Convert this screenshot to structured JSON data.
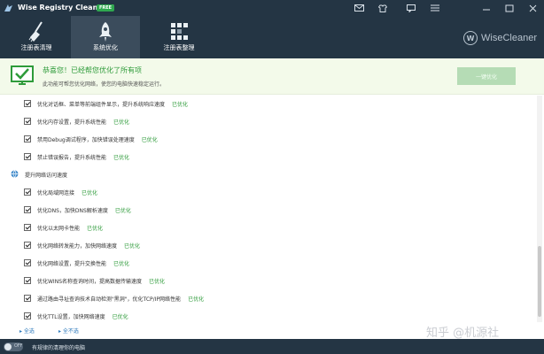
{
  "titlebar": {
    "title": "Wise Registry Cleaner X",
    "badge": "FREE"
  },
  "toolbar": {
    "tabs": [
      {
        "label": "注册表清理",
        "icon": "broom-icon",
        "active": false
      },
      {
        "label": "系统优化",
        "icon": "rocket-icon",
        "active": true
      },
      {
        "label": "注册表整理",
        "icon": "defrag-icon",
        "active": false
      }
    ],
    "brand": {
      "logo_letter": "W",
      "name": "WiseCleaner"
    }
  },
  "banner": {
    "title": "恭喜您！已经帮您优化了所有项",
    "subtitle": "此功能可帮您优化网络，使您的电脑快速稳定运行。",
    "button_label": "一键优化"
  },
  "items_top": [
    {
      "text": "优化对话框、菜单等前端组件显示，提升系统响应速度",
      "status": "已优化"
    },
    {
      "text": "优化内存设置，提升系统性能",
      "status": "已优化"
    },
    {
      "text": "禁用Debug调试程序，加快错误处理速度",
      "status": "已优化"
    },
    {
      "text": "禁止错误报告，提升系统性能",
      "status": "已优化"
    }
  ],
  "group": {
    "title": "提升网络访问速度"
  },
  "items_network": [
    {
      "text": "优化局域网连接",
      "status": "已优化"
    },
    {
      "text": "优化DNS，加快DNS解析速度",
      "status": "已优化"
    },
    {
      "text": "优化以太网卡性能",
      "status": "已优化"
    },
    {
      "text": "优化网络转发能力，加快网络速度",
      "status": "已优化"
    },
    {
      "text": "优化网络设置，提升交换性能",
      "status": "已优化"
    },
    {
      "text": "优化WINS名称查询时间，提高数据传输速度",
      "status": "已优化"
    },
    {
      "text": "通过路由寻址查询技术自动检测\"黑洞\"，优化TCP/IP网络性能",
      "status": "已优化"
    },
    {
      "text": "优化TTL设置，加快网络速度",
      "status": "已优化"
    }
  ],
  "selection": {
    "select_all": "全选",
    "select_none": "全不选"
  },
  "watermark": "知乎 @机源社",
  "footer": {
    "toggle_label": "OFF",
    "text": "有规律的清理你的电脑"
  },
  "colors": {
    "chrome": "#243544",
    "active_tab": "#3b4c5c",
    "success": "#2e9b3a",
    "link": "#2f7bbd"
  }
}
